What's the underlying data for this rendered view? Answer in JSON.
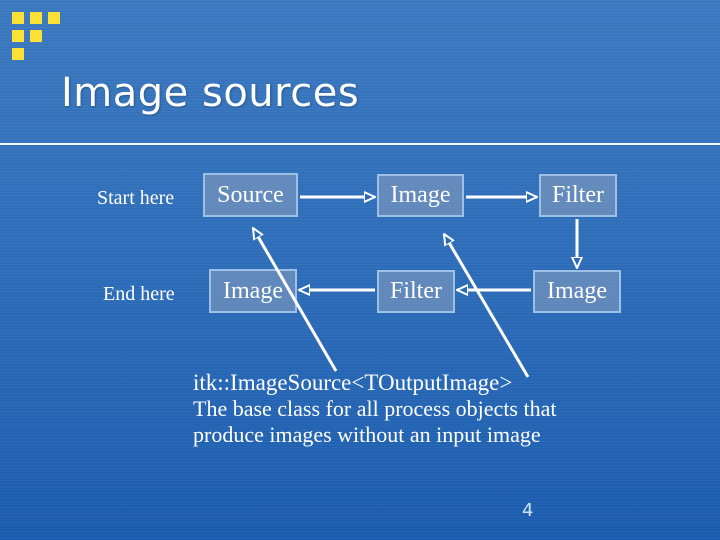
{
  "slide": {
    "title": "Image sources",
    "page_number": "4",
    "accent_color": "#fbe035",
    "background_color": "#2a6ab8"
  },
  "diagram": {
    "row_labels": {
      "start": "Start here",
      "end": "End here"
    },
    "nodes": [
      {
        "id": "source",
        "label": "Source"
      },
      {
        "id": "image-1",
        "label": "Image"
      },
      {
        "id": "filter-1",
        "label": "Filter"
      },
      {
        "id": "image-2",
        "label": "Image"
      },
      {
        "id": "filter-2",
        "label": "Filter"
      },
      {
        "id": "image-3",
        "label": "Image"
      }
    ],
    "edges": [
      {
        "from": "source",
        "to": "image-1"
      },
      {
        "from": "image-1",
        "to": "filter-1"
      },
      {
        "from": "filter-1",
        "to": "image-2"
      },
      {
        "from": "image-2",
        "to": "filter-2"
      },
      {
        "from": "filter-2",
        "to": "image-3"
      }
    ]
  },
  "description": {
    "class_name": "itk::ImageSource<TOutputImage>",
    "line1": "The base class for all process objects that",
    "line2": "produce images without an input image"
  }
}
